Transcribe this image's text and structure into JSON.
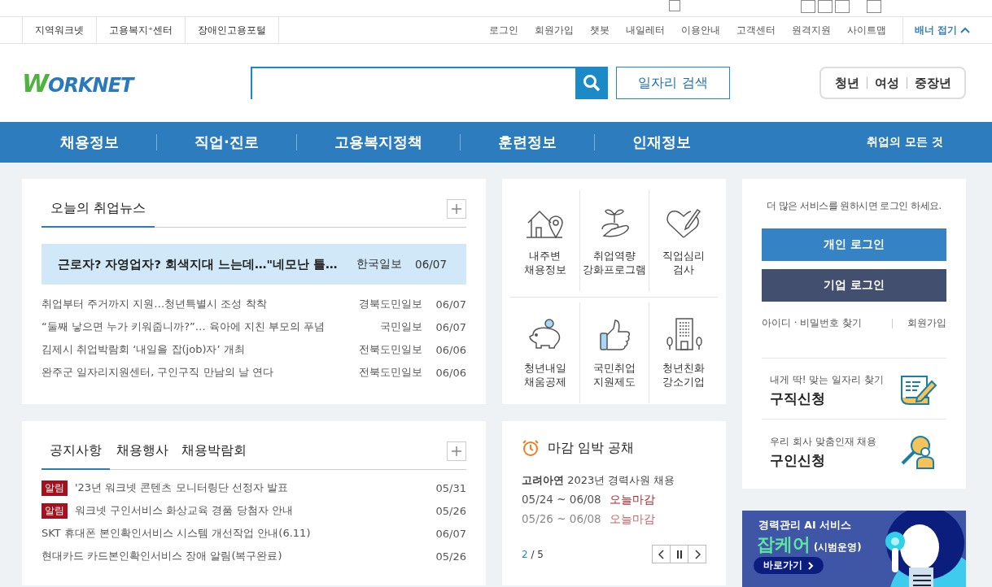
{
  "top_strip": {
    "checked": false
  },
  "util_left": [
    "지역워크넷",
    "고용복지⁺센터",
    "장애인고용포털"
  ],
  "util_right": [
    "로그인",
    "회원가입",
    "챗봇",
    "내일레터",
    "이용안내",
    "고객센터",
    "원격지원",
    "사이트맵"
  ],
  "banner_toggle": "배너 접기",
  "logo": "WORKNET",
  "search": {
    "button": "일자리 검색"
  },
  "audience": [
    "청년",
    "여성",
    "중장년"
  ],
  "nav": [
    "채용정보",
    "직업·진로",
    "고용복지정책",
    "훈련정보",
    "인재정보"
  ],
  "nav_right": "취업의 모든 것",
  "news": {
    "tabs": [
      {
        "label": "오늘의 취업뉴스",
        "selected": true
      }
    ],
    "headline": {
      "title": "근로자? 자영업자? 회색지대 느는데…\"네모난 틀…",
      "source": "한국일보",
      "date": "06/07"
    },
    "items": [
      {
        "title": "취업부터 주거까지 지원…청년특별시 조성 착착",
        "source": "경북도민일보",
        "date": "06/07"
      },
      {
        "title": "“둘째 낳으면 누가 키워줍니까?”… 육아에 지친 부모의 푸념",
        "source": "국민일보",
        "date": "06/07"
      },
      {
        "title": "김제시 취업박람회 ‘내일을 잡(job)자’ 개최",
        "source": "전북도민일보",
        "date": "06/06"
      },
      {
        "title": "완주군 일자리지원센터, 구인구직 만남의 날 연다",
        "source": "전북도민일보",
        "date": "06/06"
      }
    ]
  },
  "services": [
    {
      "kind": "house",
      "label": "내주변\n채용정보"
    },
    {
      "kind": "sprout",
      "label": "취업역량\n강화프로그램"
    },
    {
      "kind": "heart",
      "label": "직업심리\n검사"
    },
    {
      "kind": "piggy",
      "label": "청년내일\n채움공제"
    },
    {
      "kind": "thumb",
      "label": "국민취업\n지원제도"
    },
    {
      "kind": "building",
      "label": "청년친화\n강소기업"
    }
  ],
  "notices": {
    "tabs": [
      {
        "label": "공지사항",
        "selected": true
      },
      {
        "label": "채용행사",
        "selected": false
      },
      {
        "label": "채용박람회",
        "selected": false
      }
    ],
    "items": [
      {
        "badge": "알림",
        "title": "'23년 워크넷 콘텐츠 모니터링단 선정자 발표",
        "date": "05/31"
      },
      {
        "badge": "알림",
        "title": "워크넷 구인서비스 화상교육 경품 당첨자 안내",
        "date": "05/26"
      },
      {
        "title": "SKT 휴대폰 본인확인서비스 시스템 개선작업 안내(6.11)",
        "date": "06/07"
      },
      {
        "title": "현대카드 카드본인확인서비스 장애 알림(복구완료)",
        "date": "05/26"
      }
    ]
  },
  "deadline": {
    "title": "마감 임박 공채",
    "company": "고려아연",
    "job": "2023년 경력사원 채용",
    "entries": [
      {
        "period": "05/24 ~ 06/08",
        "status": "오늘마감",
        "selected": true
      },
      {
        "period": "05/26 ~ 06/08",
        "status": "오늘마감",
        "selected": false
      }
    ],
    "page": "2",
    "total": "/ 5"
  },
  "login": {
    "prompt": "더 많은 서비스를 원하시면 로그인 하세요.",
    "personal": "개인 로그인",
    "company": "기업 로그인",
    "find": "아이디 · 비밀번호 찾기",
    "join": "회원가입"
  },
  "apply": [
    {
      "kind": "seeker",
      "sub": "내게 딱! 맞는 일자리 찾기",
      "title": "구직신청"
    },
    {
      "kind": "employer",
      "sub": "우리 회사 맞춤인재 채용",
      "title": "구인신청"
    }
  ],
  "ad": {
    "line1": "경력관리 AI 서비스",
    "brand": "잡케어",
    "note": "(시범운영)",
    "cta": "바로가기"
  }
}
